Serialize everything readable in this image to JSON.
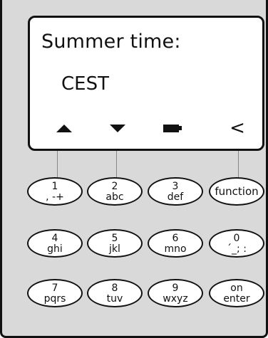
{
  "display": {
    "line1": "Summer time:",
    "line2": "CEST",
    "softkeys": {
      "up_icon": "up-arrow-icon",
      "down_icon": "down-arrow-icon",
      "battery_icon": "battery-icon",
      "back_label": "<"
    }
  },
  "keypad": {
    "row1": [
      {
        "top": "1",
        "bottom": ", -+"
      },
      {
        "top": "2",
        "bottom": "abc"
      },
      {
        "top": "3",
        "bottom": "def"
      },
      {
        "single": "function"
      }
    ],
    "row2": [
      {
        "top": "4",
        "bottom": "ghi"
      },
      {
        "top": "5",
        "bottom": "jkl"
      },
      {
        "top": "6",
        "bottom": "mno"
      },
      {
        "top": "0",
        "bottom": "´_; :"
      }
    ],
    "row3": [
      {
        "top": "7",
        "bottom": "pqrs"
      },
      {
        "top": "8",
        "bottom": "tuv"
      },
      {
        "top": "9",
        "bottom": "wxyz"
      },
      {
        "top": "on",
        "bottom": "enter"
      }
    ]
  }
}
